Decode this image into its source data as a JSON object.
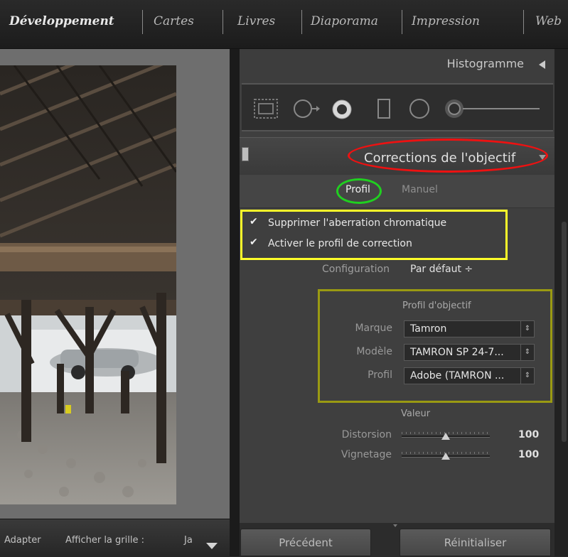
{
  "modules": [
    "Développement",
    "Cartes",
    "Livres",
    "Diaporama",
    "Impression",
    "Web"
  ],
  "toolbar": {
    "labels": [
      "Adapter",
      "Afficher la grille :",
      "Ja"
    ]
  },
  "panels": {
    "histogram_title": "Histogramme",
    "lens_title": "Corrections de l'objectif",
    "tabs": [
      "Profil",
      "Manuel"
    ],
    "active_tab": "Profil",
    "checkboxes": [
      {
        "label": "Supprimer l'aberration chromatique",
        "checked": true
      },
      {
        "label": "Activer le profil de correction",
        "checked": true
      }
    ],
    "configuration": {
      "label": "Configuration",
      "value": "Par défaut ÷"
    },
    "lens_profile": {
      "title": "Profil d'objectif",
      "fields": [
        {
          "label": "Marque",
          "value": "Tamron"
        },
        {
          "label": "Modèle",
          "value": "TAMRON SP 24-7..."
        },
        {
          "label": "Profil",
          "value": "Adobe (TAMRON ..."
        }
      ]
    },
    "amount": {
      "title": "Valeur",
      "sliders": [
        {
          "label": "Distorsion",
          "value": "100",
          "level": 0.5
        },
        {
          "label": "Vignetage",
          "value": "100",
          "level": 0.5
        }
      ]
    },
    "buttons": {
      "previous": "Précédent",
      "reset": "Réinitialiser"
    }
  },
  "colors": {
    "annotation_red": "#e11111",
    "annotation_green": "#20d020",
    "annotation_yellow": "#ffff2a",
    "annotation_olive": "#9a9a12"
  }
}
